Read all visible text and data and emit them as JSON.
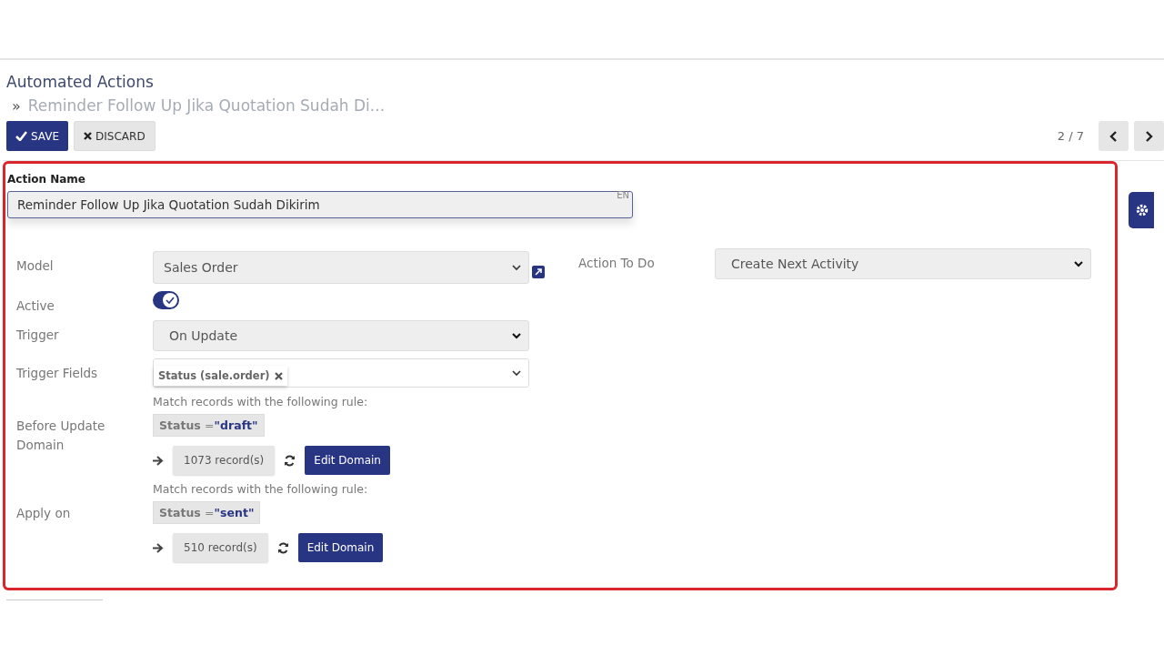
{
  "breadcrumb": {
    "parent": "Automated Actions",
    "separator": "»",
    "current": "Reminder Follow Up Jika Quotation Sudah Di..."
  },
  "buttons": {
    "save": "SAVE",
    "discard": "DISCARD"
  },
  "pager": {
    "value": "2 / 7"
  },
  "form": {
    "action_name_label": "Action Name",
    "action_name": "Reminder Follow Up Jika Quotation Sudah Dikirim",
    "language": "EN",
    "model": {
      "label": "Model",
      "value": "Sales Order"
    },
    "action_to_do": {
      "label": "Action To Do",
      "value": "Create Next Activity"
    },
    "active": {
      "label": "Active",
      "checked": true
    },
    "trigger": {
      "label": "Trigger",
      "value": "On Update"
    },
    "trigger_fields": {
      "label": "Trigger Fields",
      "tags": [
        "Status (sale.order)"
      ]
    },
    "domains": [
      {
        "label": "Before Update Domain",
        "hint": "Match records with the following rule:",
        "field": "Status",
        "operator": "=",
        "value": "\"draft\"",
        "count": "1073 record(s)",
        "edit": "Edit Domain"
      },
      {
        "label": "Apply on",
        "hint": "Match records with the following rule:",
        "field": "Status",
        "operator": "=",
        "value": "\"sent\"",
        "count": "510 record(s)",
        "edit": "Edit Domain"
      }
    ]
  }
}
